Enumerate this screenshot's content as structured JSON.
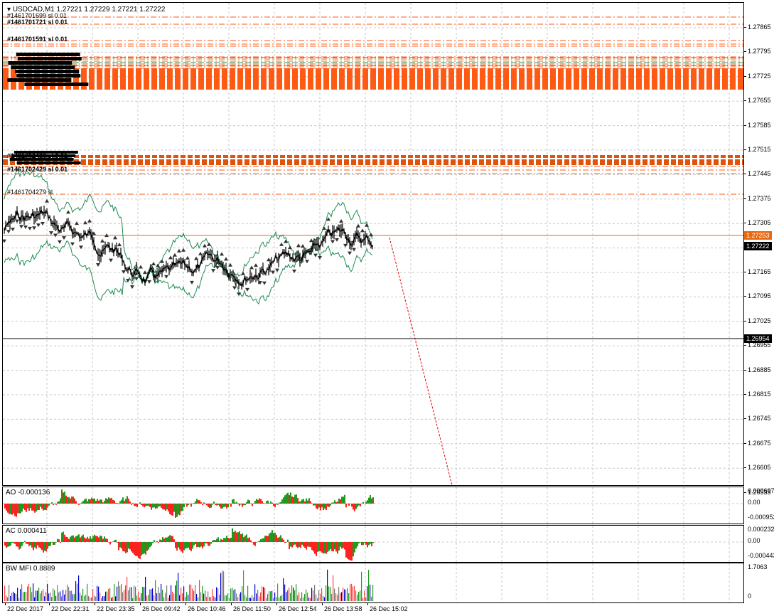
{
  "main": {
    "title": "USDCAD,M1  1.27221 1.27229 1.27221 1.27222",
    "price_labels": [
      "1.27865",
      "1.27795",
      "1.27725",
      "1.27655",
      "1.27585",
      "1.27515",
      "1.27445",
      "1.27375",
      "1.27305",
      "1.27235",
      "1.27165",
      "1.27095",
      "1.27025",
      "1.26955",
      "1.26885",
      "1.26815",
      "1.26745",
      "1.26675",
      "1.26605",
      "1.26535"
    ],
    "bid_label": "1.27253",
    "current_label": "1.27222",
    "hline_label": "1.26954",
    "order_labels": [
      "#1461701699 sl 0.01",
      "#1461701721 sl 0.01",
      "#1461701591 sl 0.01",
      "#1461702436 sl 0.01",
      "#1461702429 sl 0.01",
      "#1461704279 sl"
    ],
    "colors": {
      "bid": "#e56a13",
      "orders": "#ff5a14",
      "band": "#1f8a4e",
      "tp": "#e00000"
    }
  },
  "ao": {
    "title": "AO -0.000136",
    "labels": [
      "0.000697",
      "0.00",
      "-0.000952"
    ]
  },
  "ac": {
    "title": "AC 0.000411",
    "labels": [
      "0.000232",
      "0.00",
      "-0.000443"
    ]
  },
  "mfi": {
    "title": "BW MFI 0.8889",
    "labels": [
      "1.7063",
      "0"
    ]
  },
  "time_labels": [
    "22 Dec 2017",
    "22 Dec 22:31",
    "22 Dec 23:35",
    "26 Dec 09:42",
    "26 Dec 10:46",
    "26 Dec 11:50",
    "26 Dec 12:54",
    "26 Dec 13:58",
    "26 Dec 15:02"
  ]
}
